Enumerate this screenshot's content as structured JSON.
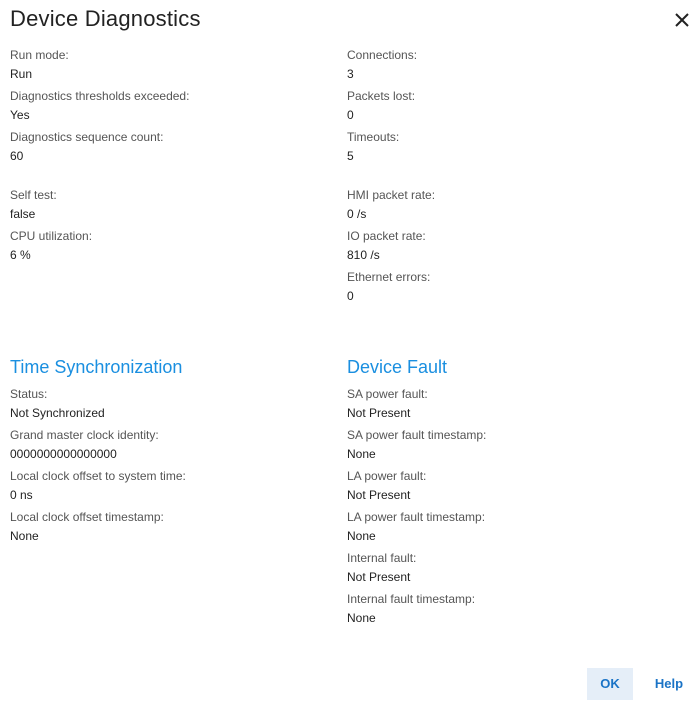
{
  "dialog": {
    "title": "Device Diagnostics"
  },
  "diag_left": [
    {
      "label": "Run mode:",
      "value": "Run"
    },
    {
      "label": "Diagnostics thresholds exceeded:",
      "value": "Yes"
    },
    {
      "label": "Diagnostics sequence count:",
      "value": "60"
    },
    {
      "label": "Self test:",
      "value": "false"
    },
    {
      "label": "CPU utilization:",
      "value": "6 %"
    }
  ],
  "diag_right": [
    {
      "label": "Connections:",
      "value": "3"
    },
    {
      "label": "Packets lost:",
      "value": "0"
    },
    {
      "label": "Timeouts:",
      "value": "5"
    },
    {
      "label": "HMI packet rate:",
      "value": "0 /s"
    },
    {
      "label": "IO packet rate:",
      "value": "810 /s"
    },
    {
      "label": "Ethernet errors:",
      "value": "0"
    }
  ],
  "time_sync": {
    "title": "Time Synchronization",
    "fields": [
      {
        "label": "Status:",
        "value": "Not Synchronized"
      },
      {
        "label": "Grand master clock identity:",
        "value": "0000000000000000"
      },
      {
        "label": "Local clock offset to system time:",
        "value": "0 ns"
      },
      {
        "label": "Local clock offset timestamp:",
        "value": "None"
      }
    ]
  },
  "device_fault": {
    "title": "Device Fault",
    "fields": [
      {
        "label": "SA power fault:",
        "value": "Not Present"
      },
      {
        "label": "SA power fault timestamp:",
        "value": "None"
      },
      {
        "label": "LA power fault:",
        "value": "Not Present"
      },
      {
        "label": "LA power fault timestamp:",
        "value": "None"
      },
      {
        "label": "Internal fault:",
        "value": "Not Present"
      },
      {
        "label": "Internal fault timestamp:",
        "value": "None"
      }
    ]
  },
  "buttons": {
    "ok": "OK",
    "help": "Help"
  },
  "colors": {
    "accent": "#1a8fe0",
    "button_bg": "#e5eef8",
    "link": "#1a73c6"
  },
  "icons": {
    "close": "close-icon"
  }
}
